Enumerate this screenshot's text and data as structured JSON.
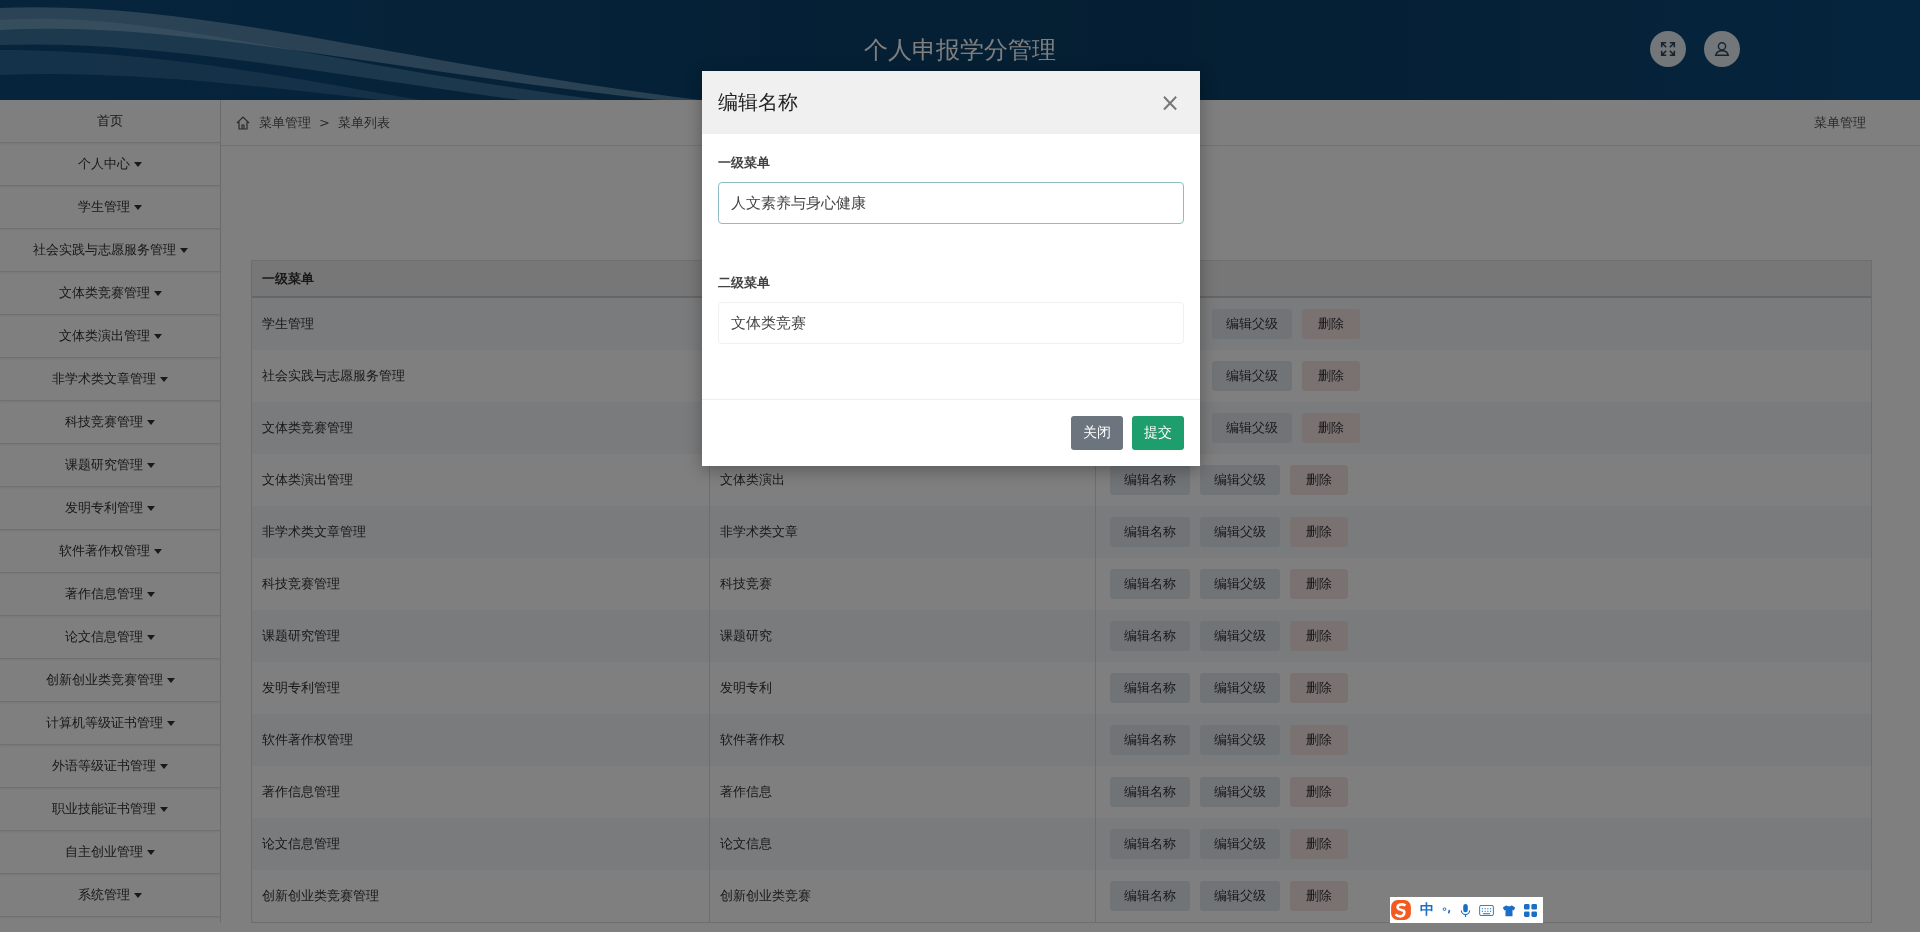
{
  "header": {
    "title": "个人申报学分管理"
  },
  "sidebar": {
    "items": [
      {
        "label": "首页",
        "has_caret": false
      },
      {
        "label": "个人中心",
        "has_caret": true
      },
      {
        "label": "学生管理",
        "has_caret": true
      },
      {
        "label": "社会实践与志愿服务管理",
        "has_caret": true
      },
      {
        "label": "文体类竞赛管理",
        "has_caret": true
      },
      {
        "label": "文体类演出管理",
        "has_caret": true
      },
      {
        "label": "非学术类文章管理",
        "has_caret": true
      },
      {
        "label": "科技竞赛管理",
        "has_caret": true
      },
      {
        "label": "课题研究管理",
        "has_caret": true
      },
      {
        "label": "发明专利管理",
        "has_caret": true
      },
      {
        "label": "软件著作权管理",
        "has_caret": true
      },
      {
        "label": "著作信息管理",
        "has_caret": true
      },
      {
        "label": "论文信息管理",
        "has_caret": true
      },
      {
        "label": "创新创业类竞赛管理",
        "has_caret": true
      },
      {
        "label": "计算机等级证书管理",
        "has_caret": true
      },
      {
        "label": "外语等级证书管理",
        "has_caret": true
      },
      {
        "label": "职业技能证书管理",
        "has_caret": true
      },
      {
        "label": "自主创业管理",
        "has_caret": true
      },
      {
        "label": "系统管理",
        "has_caret": true
      }
    ]
  },
  "breadcrumb": {
    "items": [
      "菜单管理",
      "菜单列表"
    ],
    "separator": ">",
    "right_label": "菜单管理"
  },
  "table": {
    "columns": [
      "一级菜单"
    ],
    "rows": [
      {
        "column_1": "学生管理",
        "actions": [
          {
            "label": "编辑父级",
            "kind": "parent"
          },
          {
            "label": "删除",
            "kind": "delete"
          }
        ]
      },
      {
        "column_1": "社会实践与志愿服务管理",
        "actions": [
          {
            "label": "编辑父级",
            "kind": "parent"
          },
          {
            "label": "删除",
            "kind": "delete"
          }
        ]
      },
      {
        "column_1": "文体类竞赛管理",
        "actions": [
          {
            "label": "编辑父级",
            "kind": "parent"
          },
          {
            "label": "删除",
            "kind": "delete"
          }
        ]
      },
      {
        "column_1": "文体类演出管理",
        "column_2": "文体类演出",
        "actions": [
          {
            "label": "编辑名称",
            "kind": "name"
          },
          {
            "label": "编辑父级",
            "kind": "parent"
          },
          {
            "label": "删除",
            "kind": "delete"
          }
        ]
      },
      {
        "column_1": "非学术类文章管理",
        "column_2": "非学术类文章",
        "actions": [
          {
            "label": "编辑名称",
            "kind": "name"
          },
          {
            "label": "编辑父级",
            "kind": "parent"
          },
          {
            "label": "删除",
            "kind": "delete"
          }
        ]
      },
      {
        "column_1": "科技竞赛管理",
        "column_2": "科技竞赛",
        "actions": [
          {
            "label": "编辑名称",
            "kind": "name"
          },
          {
            "label": "编辑父级",
            "kind": "parent"
          },
          {
            "label": "删除",
            "kind": "delete"
          }
        ]
      },
      {
        "column_1": "课题研究管理",
        "column_2": "课题研究",
        "actions": [
          {
            "label": "编辑名称",
            "kind": "name"
          },
          {
            "label": "编辑父级",
            "kind": "parent"
          },
          {
            "label": "删除",
            "kind": "delete"
          }
        ]
      },
      {
        "column_1": "发明专利管理",
        "column_2": "发明专利",
        "actions": [
          {
            "label": "编辑名称",
            "kind": "name"
          },
          {
            "label": "编辑父级",
            "kind": "parent"
          },
          {
            "label": "删除",
            "kind": "delete"
          }
        ]
      },
      {
        "column_1": "软件著作权管理",
        "column_2": "软件著作权",
        "actions": [
          {
            "label": "编辑名称",
            "kind": "name"
          },
          {
            "label": "编辑父级",
            "kind": "parent"
          },
          {
            "label": "删除",
            "kind": "delete"
          }
        ]
      },
      {
        "column_1": "著作信息管理",
        "column_2": "著作信息",
        "actions": [
          {
            "label": "编辑名称",
            "kind": "name"
          },
          {
            "label": "编辑父级",
            "kind": "parent"
          },
          {
            "label": "删除",
            "kind": "delete"
          }
        ]
      },
      {
        "column_1": "论文信息管理",
        "column_2": "论文信息",
        "actions": [
          {
            "label": "编辑名称",
            "kind": "name"
          },
          {
            "label": "编辑父级",
            "kind": "parent"
          },
          {
            "label": "删除",
            "kind": "delete"
          }
        ]
      },
      {
        "column_1": "创新创业类竞赛管理",
        "column_2": "创新创业类竞赛",
        "actions": [
          {
            "label": "编辑名称",
            "kind": "name"
          },
          {
            "label": "编辑父级",
            "kind": "parent"
          },
          {
            "label": "删除",
            "kind": "delete"
          }
        ]
      }
    ]
  },
  "modal": {
    "title": "编辑名称",
    "close": "×",
    "fields": [
      {
        "label": "一级菜单",
        "value": "人文素养与身心健康",
        "focused": true
      },
      {
        "label": "二级菜单",
        "value": "文体类竞赛",
        "focused": false
      }
    ],
    "buttons": [
      {
        "label": "关闭",
        "kind": "secondary"
      },
      {
        "label": "提交",
        "kind": "primary"
      }
    ]
  },
  "ime_bar": {
    "mode": "中"
  }
}
